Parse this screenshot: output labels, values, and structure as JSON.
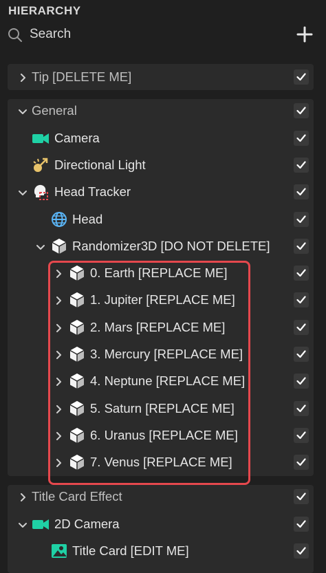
{
  "header": {
    "title": "HIERARCHY"
  },
  "search": {
    "label": "Search"
  },
  "rows": [
    {
      "label": "Tip [DELETE ME]",
      "icon": "none",
      "chevron": "right",
      "section": true,
      "checked": true
    },
    {
      "label": "General",
      "icon": "none",
      "chevron": "down",
      "section": true,
      "checked": true
    },
    {
      "label": "Camera",
      "icon": "camera-icon",
      "chevron": "none",
      "section": false,
      "checked": true
    },
    {
      "label": "Directional Light",
      "icon": "directional-light-icon",
      "chevron": "none",
      "section": false,
      "checked": true
    },
    {
      "label": "Head Tracker",
      "icon": "head-tracker-icon",
      "chevron": "down",
      "section": false,
      "checked": true
    },
    {
      "label": "Head",
      "icon": "globe-icon",
      "chevron": "none",
      "section": false,
      "checked": true
    },
    {
      "label": "Randomizer3D [DO NOT DELETE]",
      "icon": "scene-object-icon",
      "chevron": "down",
      "section": false,
      "checked": true
    },
    {
      "label": "0. Earth [REPLACE ME]",
      "icon": "scene-object-icon",
      "chevron": "right",
      "section": false,
      "checked": true
    },
    {
      "label": "1. Jupiter [REPLACE ME]",
      "icon": "scene-object-icon",
      "chevron": "right",
      "section": false,
      "checked": true
    },
    {
      "label": "2. Mars [REPLACE ME]",
      "icon": "scene-object-icon",
      "chevron": "right",
      "section": false,
      "checked": true
    },
    {
      "label": "3. Mercury [REPLACE ME]",
      "icon": "scene-object-icon",
      "chevron": "right",
      "section": false,
      "checked": true
    },
    {
      "label": "4. Neptune [REPLACE ME]",
      "icon": "scene-object-icon",
      "chevron": "right",
      "section": false,
      "checked": true
    },
    {
      "label": "5. Saturn [REPLACE ME]",
      "icon": "scene-object-icon",
      "chevron": "right",
      "section": false,
      "checked": true
    },
    {
      "label": "6. Uranus [REPLACE ME]",
      "icon": "scene-object-icon",
      "chevron": "right",
      "section": false,
      "checked": true
    },
    {
      "label": "7. Venus [REPLACE ME]",
      "icon": "scene-object-icon",
      "chevron": "right",
      "section": false,
      "checked": true
    },
    {
      "label": "Title Card Effect",
      "icon": "none",
      "chevron": "right",
      "section": true,
      "checked": true
    },
    {
      "label": "2D Camera",
      "icon": "camera-icon",
      "chevron": "down",
      "section": false,
      "checked": true
    },
    {
      "label": "Title Card [EDIT ME]",
      "icon": "image-icon",
      "chevron": "none",
      "section": false,
      "checked": true
    }
  ],
  "colors": {
    "accent_teal": "#1fd1a5",
    "highlight_red": "#e5484d",
    "light_yellow": "#e8c36a",
    "globe_blue": "#5ab4f5"
  }
}
